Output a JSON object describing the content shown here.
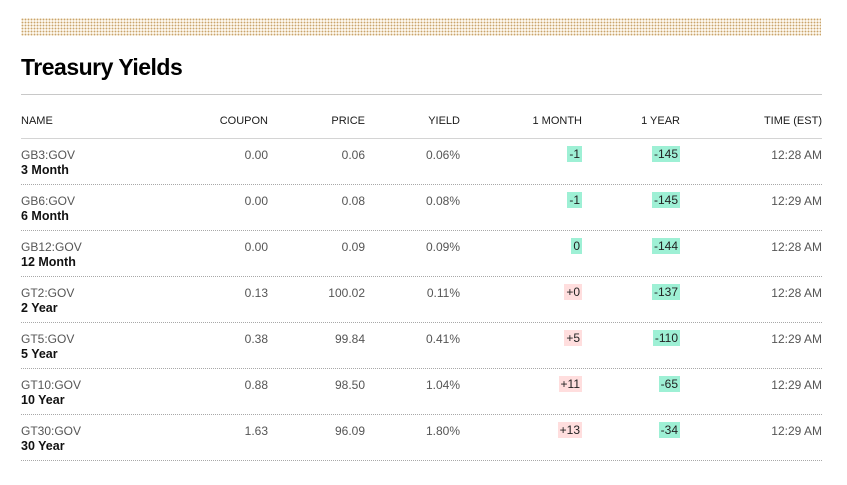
{
  "title": "Treasury Yields",
  "colors": {
    "positive_bg": "#ffdede",
    "negative_bg": "#9ef0d5",
    "band": "#c9a46b"
  },
  "headers": {
    "name": "NAME",
    "coupon": "COUPON",
    "price": "PRICE",
    "yield": "YIELD",
    "month1": "1 MONTH",
    "year1": "1 YEAR",
    "time": "TIME (EST)"
  },
  "rows": [
    {
      "ticker": "GB3:GOV",
      "label": "3 Month",
      "coupon": "0.00",
      "price": "0.06",
      "yield": "0.06%",
      "month1": "-1",
      "year1": "-145",
      "time": "12:28 AM"
    },
    {
      "ticker": "GB6:GOV",
      "label": "6 Month",
      "coupon": "0.00",
      "price": "0.08",
      "yield": "0.08%",
      "month1": "-1",
      "year1": "-145",
      "time": "12:29 AM"
    },
    {
      "ticker": "GB12:GOV",
      "label": "12 Month",
      "coupon": "0.00",
      "price": "0.09",
      "yield": "0.09%",
      "month1": "0",
      "year1": "-144",
      "time": "12:28 AM"
    },
    {
      "ticker": "GT2:GOV",
      "label": "2 Year",
      "coupon": "0.13",
      "price": "100.02",
      "yield": "0.11%",
      "month1": "+0",
      "year1": "-137",
      "time": "12:28 AM"
    },
    {
      "ticker": "GT5:GOV",
      "label": "5 Year",
      "coupon": "0.38",
      "price": "99.84",
      "yield": "0.41%",
      "month1": "+5",
      "year1": "-110",
      "time": "12:29 AM"
    },
    {
      "ticker": "GT10:GOV",
      "label": "10 Year",
      "coupon": "0.88",
      "price": "98.50",
      "yield": "1.04%",
      "month1": "+11",
      "year1": "-65",
      "time": "12:29 AM"
    },
    {
      "ticker": "GT30:GOV",
      "label": "30 Year",
      "coupon": "1.63",
      "price": "96.09",
      "yield": "1.80%",
      "month1": "+13",
      "year1": "-34",
      "time": "12:29 AM"
    }
  ]
}
